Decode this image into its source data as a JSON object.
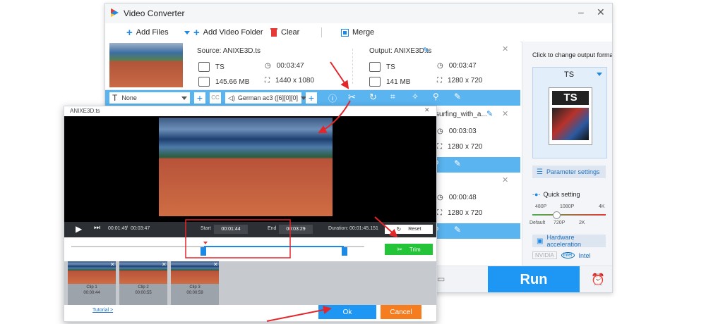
{
  "app": {
    "title": "Video Converter"
  },
  "toolbar": {
    "add_files": "Add Files",
    "add_video_folder": "Add Video Folder",
    "clear": "Clear",
    "merge": "Merge"
  },
  "file1": {
    "source": "Source: ANIXE3D.ts",
    "src_format": "TS",
    "src_duration": "00:03:47",
    "src_size": "145.66 MB",
    "src_res": "1440 x 1080",
    "output": "Output: ANIXE3D.ts",
    "out_format": "TS",
    "out_duration": "00:03:47",
    "out_size": "141 MB",
    "out_res": "1280 x 720"
  },
  "file2": {
    "name": "surfing_with_a...",
    "duration": "00:03:03",
    "res": "1280 x 720"
  },
  "file3": {
    "duration": "00:00:48",
    "res": "1280 x 720"
  },
  "filter_bar": {
    "subtitle": "None",
    "audio": "German ac3 ([6][0][0]"
  },
  "right_panel": {
    "change_format": "Click to change output format:",
    "format": "TS",
    "format_icon_label": "TS",
    "parameter_settings": "Parameter settings",
    "quick_setting": "Quick setting",
    "scale_top": [
      "480P",
      "1080P",
      "4K"
    ],
    "scale_bottom": [
      "Default",
      "720P",
      "2K"
    ],
    "quick_setting_level": 0.33,
    "hw_accel": "Hardware acceleration",
    "nvidia": "NVIDIA",
    "intel": "Intel",
    "intel_logo": "intel",
    "run": "Run"
  },
  "dialog": {
    "title": "ANIXE3D.ts",
    "current_time": "00:01:45",
    "separator": "/",
    "total_time": "00:03:47",
    "start_label": "Start",
    "start_value": "00:01:44",
    "end_label": "End",
    "end_value": "00:03:29",
    "duration_label": "Duration:",
    "duration_value": "00:01:45.151",
    "reset": "Reset",
    "trim": "Trim",
    "clips": [
      {
        "label": "Clip 1",
        "time": "00:00:44"
      },
      {
        "label": "Clip 2",
        "time": "00:00:55"
      },
      {
        "label": "Clip 3",
        "time": "00:00:59"
      }
    ],
    "tutorial": "Tutorial >",
    "ok": "Ok",
    "cancel": "Cancel"
  },
  "colors": {
    "accent": "#1e88e5",
    "bar": "#5ab4f0",
    "trim": "#23c437",
    "cancel": "#f57c1f",
    "arrow": "#e3262a"
  }
}
